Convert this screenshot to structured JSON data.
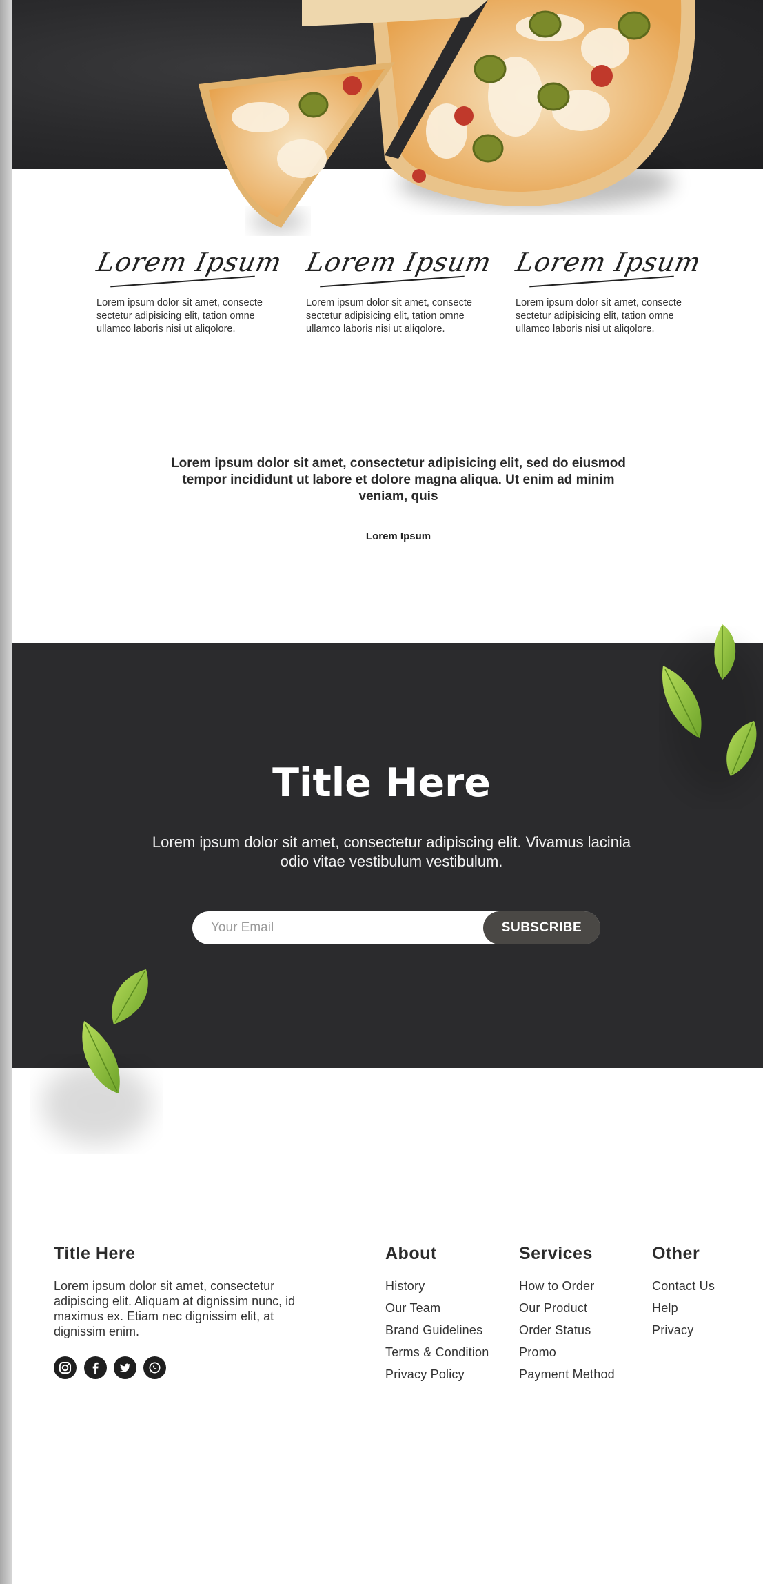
{
  "features": [
    {
      "heading": "Lorem Ipsum",
      "text": "Lorem ipsum dolor sit amet, consecte sectetur adipisicing elit, tation omne ullamco laboris nisi ut aliqolore."
    },
    {
      "heading": "Lorem Ipsum",
      "text": "Lorem ipsum dolor sit amet, consecte sectetur adipisicing elit, tation omne ullamco laboris nisi ut aliqolore."
    },
    {
      "heading": "Lorem Ipsum",
      "text": "Lorem ipsum dolor sit amet, consecte sectetur adipisicing elit, tation omne ullamco laboris nisi ut aliqolore."
    }
  ],
  "testimonial": {
    "quote": "Lorem ipsum dolor sit amet, consectetur adipisicing elit, sed do eiusmod tempor incididunt ut labore et dolore magna aliqua. Ut enim ad minim veniam, quis",
    "author": "Lorem Ipsum"
  },
  "newsletter": {
    "title": "Title Here",
    "text": "Lorem ipsum dolor sit amet, consectetur adipiscing elit. Vivamus lacinia odio vitae vestibulum vestibulum.",
    "email_placeholder": "Your Email",
    "button_label": "SUBSCRIBE"
  },
  "footer": {
    "brand_title": "Title Here",
    "brand_text": "Lorem ipsum dolor sit amet, consectetur adipiscing elit. Aliquam at dignissim nunc, id maximus ex. Etiam nec dignissim elit, at dignissim enim.",
    "social_icons": [
      "instagram-icon",
      "facebook-icon",
      "twitter-icon",
      "whatsapp-icon"
    ],
    "columns": [
      {
        "title": "About",
        "links": [
          "History",
          "Our Team",
          "Brand Guidelines",
          "Terms & Condition",
          "Privacy Policy"
        ]
      },
      {
        "title": "Services",
        "links": [
          "How to Order",
          "Our Product",
          "Order Status",
          "Promo",
          "Payment Method"
        ]
      },
      {
        "title": "Other",
        "links": [
          "Contact Us",
          "Help",
          "Privacy"
        ]
      }
    ]
  },
  "colors": {
    "dark_background": "#2b2b2d",
    "button_background": "#4a4845",
    "leaf_green": "#8dc63f"
  }
}
